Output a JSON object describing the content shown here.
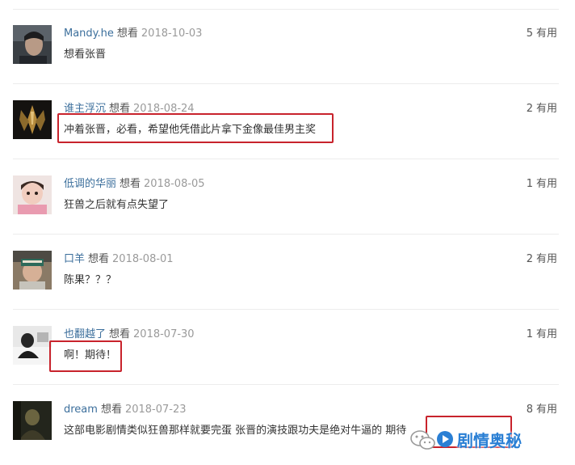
{
  "comments": [
    {
      "user": "Mandy.he",
      "status": "想看",
      "date": "2018-10-03",
      "content": "想看张晋",
      "useful_count": "5",
      "useful_label": "有用"
    },
    {
      "user": "谁主浮沉",
      "status": "想看",
      "date": "2018-08-24",
      "content": "冲着张晋，必看，希望他凭借此片拿下金像最佳男主奖",
      "useful_count": "2",
      "useful_label": "有用"
    },
    {
      "user": "低调的华丽",
      "status": "想看",
      "date": "2018-08-05",
      "content": "狂兽之后就有点失望了",
      "useful_count": "1",
      "useful_label": "有用"
    },
    {
      "user": "口羊",
      "status": "想看",
      "date": "2018-08-01",
      "content": "陈果？？？",
      "useful_count": "2",
      "useful_label": "有用"
    },
    {
      "user": "也翻越了",
      "status": "想看",
      "date": "2018-07-30",
      "content": "啊！期待！",
      "useful_count": "1",
      "useful_label": "有用"
    },
    {
      "user": "dream",
      "status": "想看",
      "date": "2018-07-23",
      "content": "这部电影剧情类似狂兽那样就要完蛋 张晋的演技跟功夫是绝对牛逼的 期待",
      "useful_count": "8",
      "useful_label": "有用"
    }
  ],
  "watermark": {
    "text": "剧情奥秘",
    "icon": "wechat-logo-icon"
  },
  "colors": {
    "highlight": "#c8232c",
    "username": "#3c6f9c",
    "watermark": "#2a7fd4"
  }
}
